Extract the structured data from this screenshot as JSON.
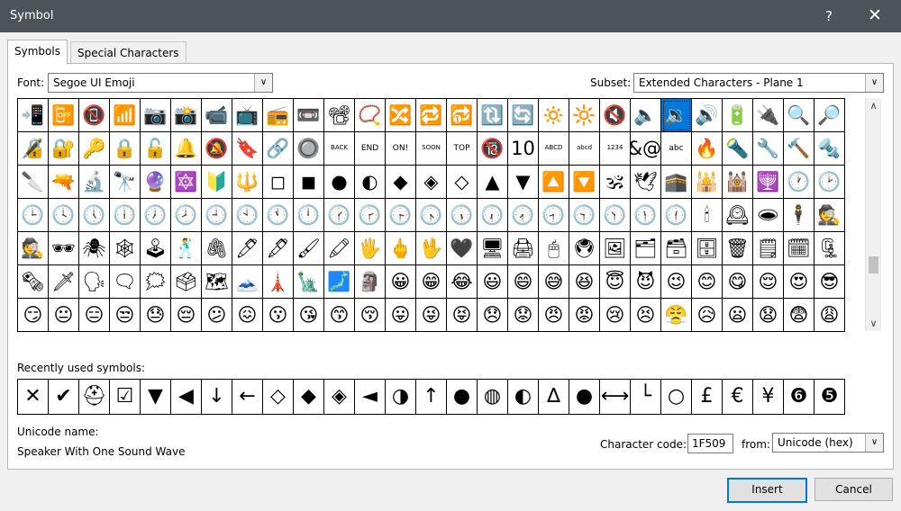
{
  "window": {
    "title": "Symbol",
    "help_label": "?",
    "close_label": "✕"
  },
  "tabs": [
    {
      "label": "Symbols",
      "active": true
    },
    {
      "label": "Special Characters",
      "active": false
    }
  ],
  "font_label": "Font:",
  "font_value": "Segoe UI Emoji",
  "subset_label": "Subset:",
  "subset_value": "Extended Characters - Plane 1",
  "dropdown_arrow": "∨",
  "symbols_rows": [
    [
      "📲",
      "📴",
      "📵",
      "📶",
      "📷",
      "📸",
      "📹",
      "📺",
      "📻",
      "📼",
      "📽",
      "📿",
      "🔀",
      "🔁",
      "🔂",
      "🔃",
      "🔄",
      "🔅",
      "🔆",
      "🔇",
      "🔈",
      "🔉",
      "🔊",
      "🔋",
      "🔌",
      "🔍",
      "🔎"
    ],
    [
      "🔏",
      "🔐",
      "🔑",
      "🔒",
      "🔓",
      "🔔",
      "🔕",
      "🔖",
      "🔗",
      "🔘",
      "BACK",
      "END",
      "ON!",
      "SOON",
      "TOP",
      "🔞",
      "10",
      "ABCD",
      "abcd",
      "1234",
      "#&@%",
      "abc",
      "🔥",
      "🔦",
      "🔧",
      "🔨",
      "🔩"
    ],
    [
      "🔪",
      "🔫",
      "🔬",
      "🔭",
      "🔮",
      "🔯",
      "🔰",
      "🔱",
      "◻",
      "◼",
      "●",
      "◐",
      "◆",
      "◈",
      "◇",
      "▲",
      "▼",
      "🔼",
      "🔽",
      "🕉",
      "🕊",
      "🕋",
      "🕌",
      "🕍",
      "🕎",
      "🕐",
      "🕑"
    ],
    [
      "🕒",
      "🕓",
      "🕔",
      "🕕",
      "🕖",
      "🕗",
      "🕘",
      "🕙",
      "🕚",
      "🕛",
      "🕜",
      "🕝",
      "🕞",
      "🕟",
      "🕠",
      "🕡",
      "🕢",
      "🕣",
      "🕤",
      "🕥",
      "🕦",
      "🕧",
      "🕯",
      "🕰",
      "🕳",
      "🕴",
      "🕵"
    ],
    [
      "🕵",
      "🕶",
      "🕷",
      "🕸",
      "🕹",
      "🕺",
      "🖇",
      "🖊",
      "🖋",
      "🖌",
      "🖍",
      "🖐",
      "🖕",
      "🖖",
      "🖤",
      "🖥",
      "🖨",
      "🖱",
      "🖲",
      "🖼",
      "🗂",
      "🗃",
      "🗄",
      "🗑",
      "🗒",
      "🗓",
      "🗜",
      "🗝"
    ],
    [
      "🗞",
      "🗡",
      "🗣",
      "🗨",
      "🗯",
      "🗳",
      "🗺",
      "🗻",
      "🗼",
      "🗽",
      "🗾",
      "🗿",
      "😀",
      "😁",
      "😂",
      "😃",
      "😄",
      "😅",
      "😆",
      "😇",
      "😈",
      "😉",
      "😊",
      "😋",
      "😌",
      "😍",
      "😎"
    ],
    [
      "😏",
      "😐",
      "😑",
      "😒",
      "😓",
      "😔",
      "😕",
      "😖",
      "😗",
      "😘",
      "😙",
      "😚",
      "😛",
      "😜",
      "😝",
      "😞",
      "😟",
      "😠",
      "😡",
      "😢",
      "😣",
      "😤",
      "😥",
      "😦",
      "😧",
      "😨",
      "😩"
    ]
  ],
  "selected_symbol": {
    "row": 0,
    "col": 21
  },
  "scroll_up": "∧",
  "scroll_down": "∨",
  "recent_label": "Recently used symbols:",
  "recent_symbols": [
    "✕",
    "✔",
    "⛑",
    "☑",
    "▼",
    "◀",
    "↓",
    "←",
    "◇",
    "◆",
    "◈",
    "◄",
    "◑",
    "↑",
    "●",
    "◍",
    "◐",
    "∆",
    "●",
    "⟷",
    "└",
    "○",
    "£",
    "€",
    "¥",
    "❻",
    "❺"
  ],
  "unicode_name_label": "Unicode name:",
  "unicode_name_value": "Speaker With One Sound Wave",
  "char_code_label": "Character code:",
  "char_code_value": "1F509",
  "from_label": "from:",
  "from_value": "Unicode (hex)",
  "buttons": {
    "insert": "Insert",
    "cancel": "Cancel"
  },
  "colors": {
    "titlebar": "#4d5359",
    "selection": "#0078d7",
    "dialog_bg": "#f0f0f0"
  }
}
